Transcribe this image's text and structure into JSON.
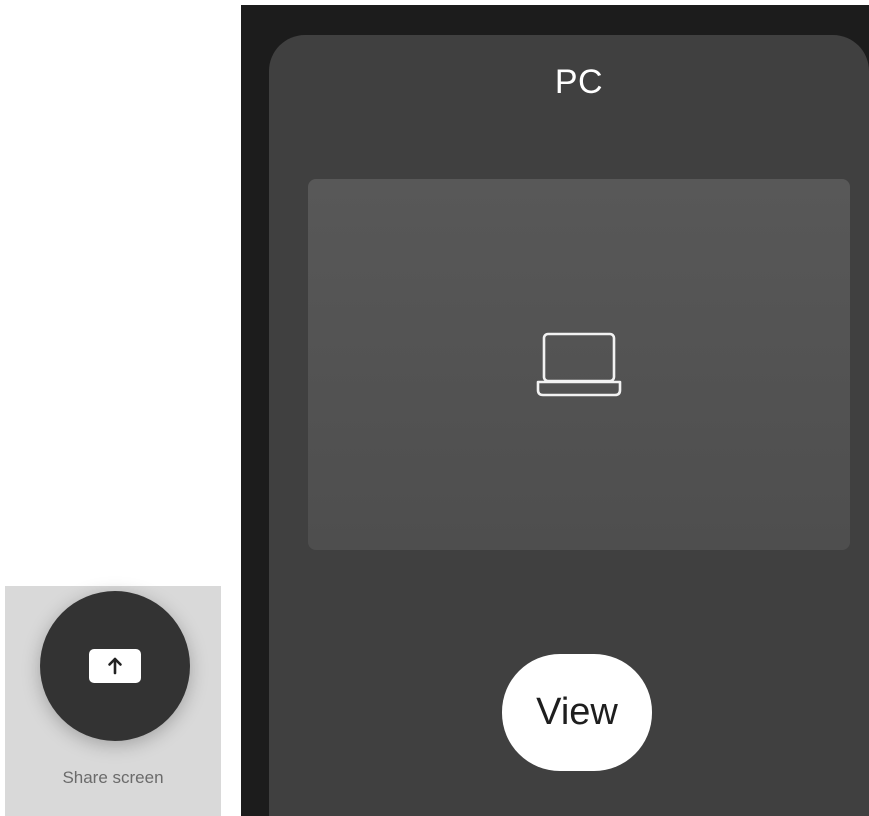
{
  "share": {
    "label": "Share screen",
    "icon": "share-screen-upload-icon"
  },
  "device": {
    "title": "PC",
    "preview_icon": "laptop-icon",
    "view_label": "View"
  },
  "colors": {
    "panel_background": "#1c1c1c",
    "card_background": "#404040",
    "preview_background": "#555555",
    "share_tile_background": "#d9d9d9",
    "share_button_background": "#333333",
    "view_button_background": "#ffffff"
  }
}
